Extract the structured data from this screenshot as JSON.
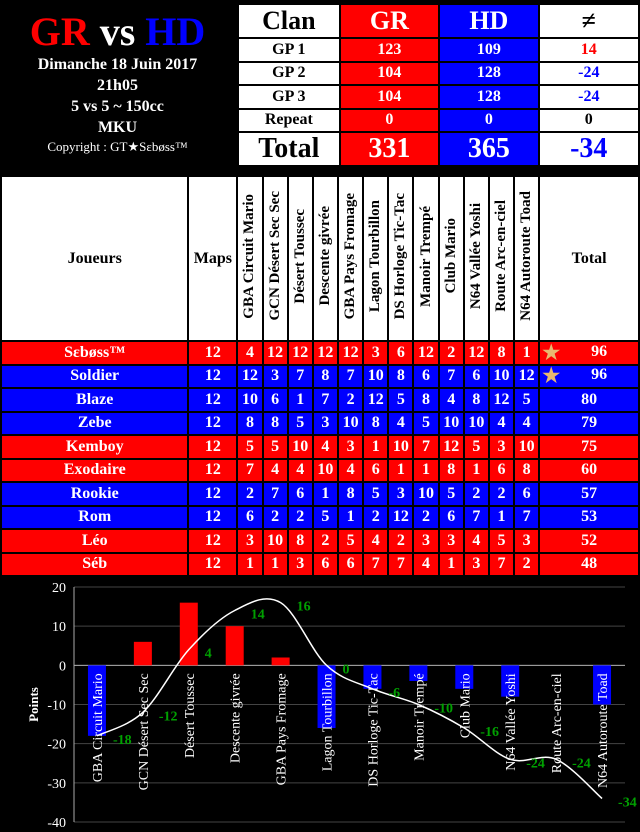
{
  "info": {
    "team1": "GR",
    "vs": "vs",
    "team2": "HD",
    "date": "Dimanche 18 Juin 2017",
    "time": "21h05",
    "format": "5 vs 5 ~ 150cc",
    "game": "MKU",
    "copyright": "Copyright : GT★Sεbøss™"
  },
  "score": {
    "headers": [
      "Clan",
      "GR",
      "HD",
      "≠"
    ],
    "rows": [
      {
        "label": "GP 1",
        "gr": "123",
        "hd": "109",
        "diff": "14",
        "diff_color": "#ff0000"
      },
      {
        "label": "GP 2",
        "gr": "104",
        "hd": "128",
        "diff": "-24",
        "diff_color": "#0000ff"
      },
      {
        "label": "GP 3",
        "gr": "104",
        "hd": "128",
        "diff": "-24",
        "diff_color": "#0000ff"
      },
      {
        "label": "Repeat",
        "gr": "0",
        "hd": "0",
        "diff": "0",
        "diff_color": "#000000"
      },
      {
        "label": "Total",
        "gr": "331",
        "hd": "365",
        "diff": "-34",
        "diff_color": "#0000ff"
      }
    ]
  },
  "players": {
    "headers": {
      "name": "Joueurs",
      "maps": "Maps",
      "total": "Total"
    },
    "tracks": [
      "GBA Circuit Mario",
      "GCN Désert Sec Sec",
      "Désert Toussec",
      "Descente givrée",
      "GBA Pays Fromage",
      "Lagon Tourbillon",
      "DS Horloge Tic-Tac",
      "Manoir Trempé",
      "Club Mario",
      "N64 Vallée Yoshi",
      "Route Arc-en-ciel",
      "N64 Autoroute Toad"
    ],
    "rows": [
      {
        "name": "Sεbøss™",
        "team": "red",
        "maps": "12",
        "scores": [
          "4",
          "12",
          "12",
          "12",
          "12",
          "3",
          "6",
          "12",
          "2",
          "12",
          "8",
          "1"
        ],
        "total": "96",
        "star": true
      },
      {
        "name": "Soldier",
        "team": "blue",
        "maps": "12",
        "scores": [
          "12",
          "3",
          "7",
          "8",
          "7",
          "10",
          "8",
          "6",
          "7",
          "6",
          "10",
          "12"
        ],
        "total": "96",
        "star": true
      },
      {
        "name": "Blaze",
        "team": "blue",
        "maps": "12",
        "scores": [
          "10",
          "6",
          "1",
          "7",
          "2",
          "12",
          "5",
          "8",
          "4",
          "8",
          "12",
          "5"
        ],
        "total": "80"
      },
      {
        "name": "Zebe",
        "team": "blue",
        "maps": "12",
        "scores": [
          "8",
          "8",
          "5",
          "3",
          "10",
          "8",
          "4",
          "5",
          "10",
          "10",
          "4",
          "4"
        ],
        "total": "79"
      },
      {
        "name": "Kemboy",
        "team": "red",
        "maps": "12",
        "scores": [
          "5",
          "5",
          "10",
          "4",
          "3",
          "1",
          "10",
          "7",
          "12",
          "5",
          "3",
          "10"
        ],
        "total": "75"
      },
      {
        "name": "Exodaire",
        "team": "red",
        "maps": "12",
        "scores": [
          "7",
          "4",
          "4",
          "10",
          "4",
          "6",
          "1",
          "1",
          "8",
          "1",
          "6",
          "8"
        ],
        "total": "60"
      },
      {
        "name": "Rookie",
        "team": "blue",
        "maps": "12",
        "scores": [
          "2",
          "7",
          "6",
          "1",
          "8",
          "5",
          "3",
          "10",
          "5",
          "2",
          "2",
          "6"
        ],
        "total": "57"
      },
      {
        "name": "Rom",
        "team": "blue",
        "maps": "12",
        "scores": [
          "6",
          "2",
          "2",
          "5",
          "1",
          "2",
          "12",
          "2",
          "6",
          "7",
          "1",
          "7"
        ],
        "total": "53"
      },
      {
        "name": "Léo",
        "team": "red",
        "maps": "12",
        "scores": [
          "3",
          "10",
          "8",
          "2",
          "5",
          "4",
          "2",
          "3",
          "3",
          "4",
          "5",
          "3"
        ],
        "total": "52"
      },
      {
        "name": "Séb",
        "team": "red",
        "maps": "12",
        "scores": [
          "1",
          "1",
          "3",
          "6",
          "6",
          "7",
          "7",
          "4",
          "1",
          "3",
          "7",
          "2"
        ],
        "total": "48"
      }
    ]
  },
  "colors": {
    "gr": "#ff0000",
    "hd": "#0000ff",
    "star": "#e8b870",
    "cumulative_label": "#00a000"
  },
  "chart_data": {
    "type": "bar+line",
    "ylabel": "Points",
    "ylim": [
      -40,
      20
    ],
    "yticks": [
      "20",
      "10",
      "0",
      "-10",
      "-20",
      "-30",
      "-40"
    ],
    "grid": true,
    "categories": [
      "GBA Circuit Mario",
      "GCN Désert Sec Sec",
      "Désert Toussec",
      "Descente givrée",
      "GBA Pays Fromage",
      "Lagon Tourbillon",
      "DS Horloge Tic-Tac",
      "Manoir Trempé",
      "Club Mario",
      "N64 Vallée Yoshi",
      "Route Arc-en-ciel",
      "N64 Autoroute Toad"
    ],
    "bars": [
      -18,
      6,
      16,
      10,
      2,
      -16,
      -6,
      -4,
      -6,
      -8,
      0,
      -10
    ],
    "cumulative": [
      -18,
      -12,
      4,
      14,
      16,
      0,
      -6,
      -10,
      -16,
      -24,
      -24,
      -34
    ]
  }
}
